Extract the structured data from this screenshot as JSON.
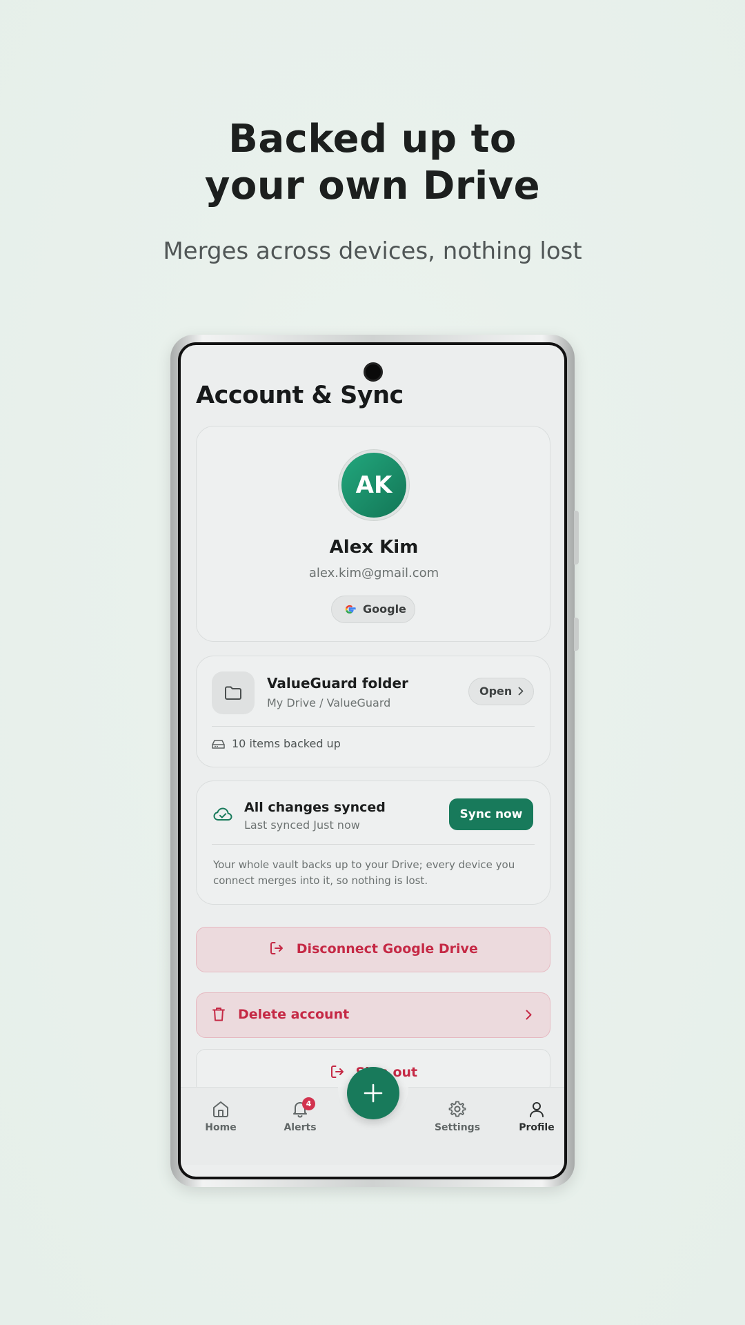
{
  "hero": {
    "title_line1": "Backed up to",
    "title_line2": "your own Drive",
    "subtitle": "Merges across devices, nothing lost"
  },
  "screen": {
    "title": "Account & Sync"
  },
  "profile": {
    "initials": "AK",
    "name": "Alex Kim",
    "email": "alex.kim@gmail.com",
    "provider": "Google"
  },
  "folder": {
    "title": "ValueGuard folder",
    "path": "My Drive / ValueGuard",
    "open_label": "Open",
    "backup_status": "10 items backed up"
  },
  "sync": {
    "title": "All changes synced",
    "subtitle": "Last synced Just now",
    "button_label": "Sync now",
    "note": "Your whole vault backs up to your Drive; every device you connect merges into it, so nothing is lost."
  },
  "actions": {
    "disconnect_label": "Disconnect Google Drive",
    "delete_label": "Delete account",
    "signout_label": "Sign out"
  },
  "nav": {
    "home": "Home",
    "alerts": "Alerts",
    "alerts_badge": "4",
    "settings": "Settings",
    "profile": "Profile",
    "active": "Profile"
  },
  "colors": {
    "accent": "#187a5b",
    "danger": "#c52945",
    "badge": "#d2334f"
  },
  "icons": {
    "folder": "folder-icon",
    "drive": "hard-drive-icon",
    "sync": "cloud-check-icon",
    "disconnect": "logout-icon",
    "delete": "trash-icon",
    "fab": "plus-icon"
  }
}
